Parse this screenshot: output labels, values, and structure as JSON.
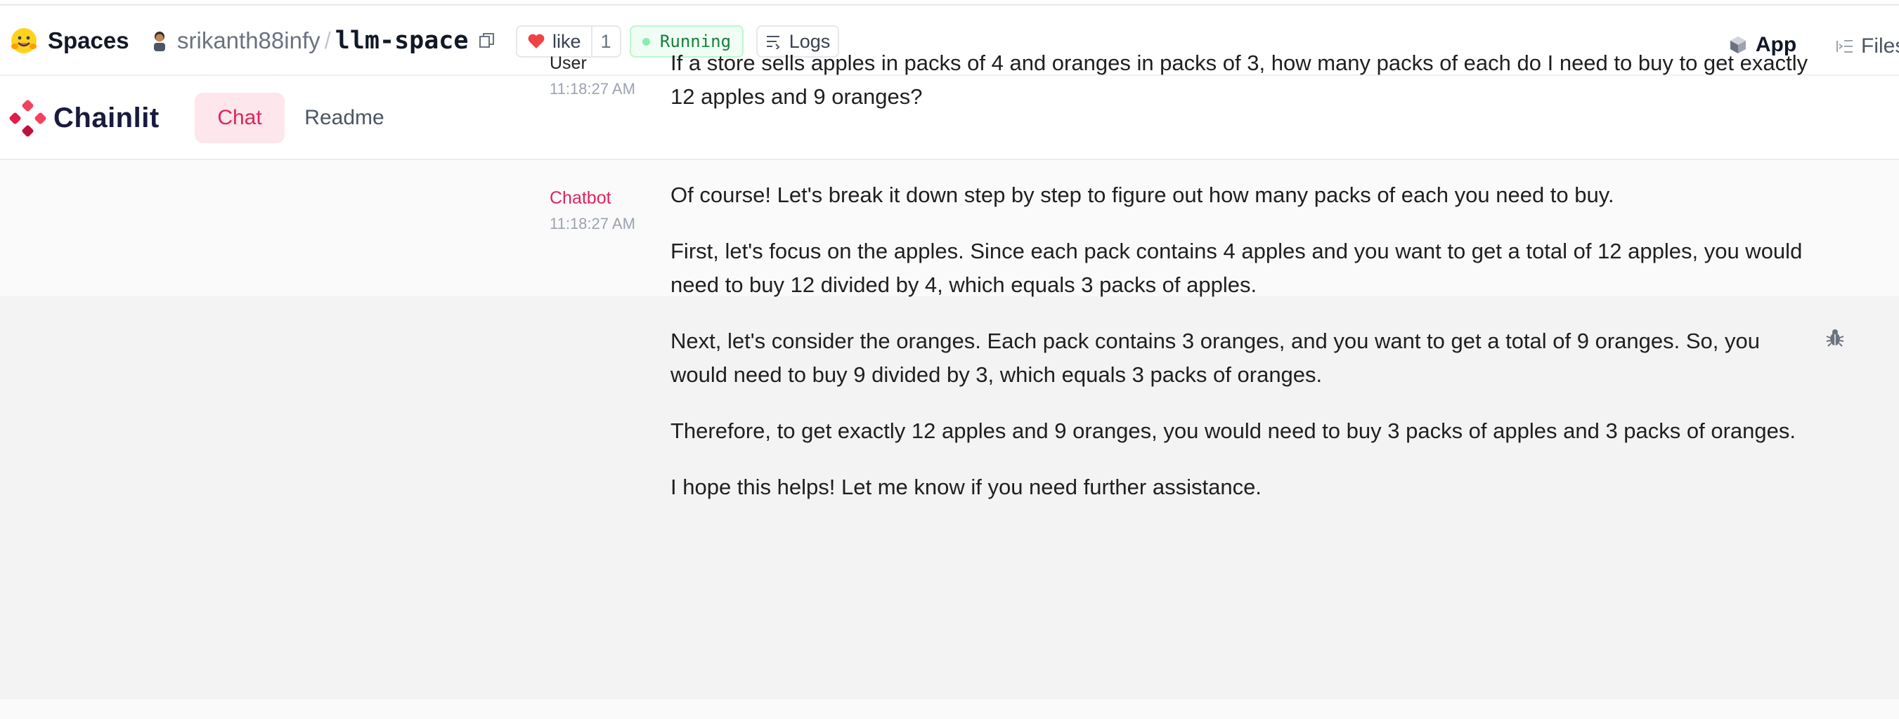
{
  "hf": {
    "brand_label": "Spaces",
    "owner": "srikanth88infy",
    "separator": "/",
    "space_name": "llm-space",
    "like_label": "like",
    "like_count": "1",
    "status": "Running",
    "logs_label": "Logs",
    "tab_app": "App",
    "tab_files": "Files"
  },
  "chainlit": {
    "logo_text": "Chainlit",
    "tabs": [
      {
        "label": "Chat",
        "active": true
      },
      {
        "label": "Readme",
        "active": false
      }
    ]
  },
  "messages": [
    {
      "author": "User",
      "time": "11:18:27 AM",
      "paragraphs": [
        "If a store sells apples in packs of 4 and oranges in packs of 3, how many packs of each do I need to buy to get exactly 12 apples and 9 oranges?"
      ]
    },
    {
      "author": "Chatbot",
      "time": "11:18:27 AM",
      "paragraphs": [
        "Of course! Let's break it down step by step to figure out how many packs of each you need to buy.",
        "First, let's focus on the apples. Since each pack contains 4 apples and you want to get a total of 12 apples, you would need to buy 12 divided by 4, which equals 3 packs of apples.",
        "Next, let's consider the oranges. Each pack contains 3 oranges, and you want to get a total of 9 oranges. So, you would need to buy 9 divided by 3, which equals 3 packs of oranges.",
        "Therefore, to get exactly 12 apples and 9 oranges, you would need to buy 3 packs of apples and 3 packs of oranges.",
        "I hope this helps! Let me know if you need further assistance."
      ]
    }
  ],
  "colors": {
    "accent": "#e0245e",
    "running": "#15803d",
    "heart": "#ef4444"
  }
}
